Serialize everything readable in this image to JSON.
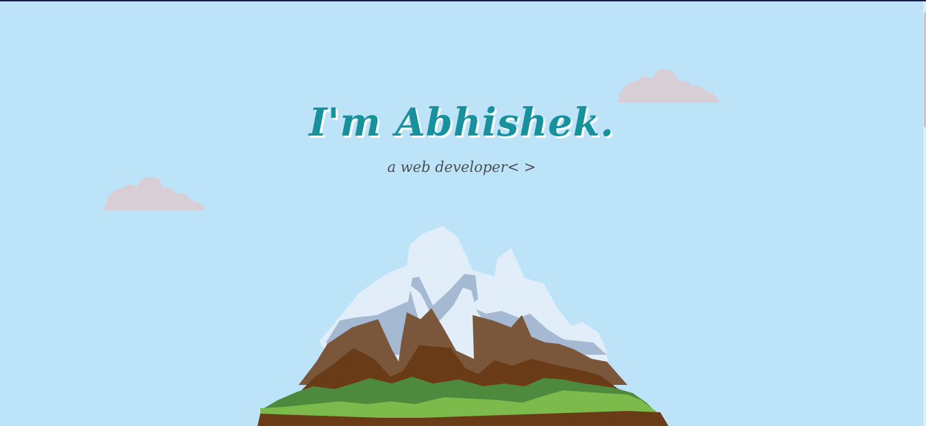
{
  "hero": {
    "title": "I'm Abhishek.",
    "subtitle": "a web developer< >"
  },
  "colors": {
    "sky": "#bde3f9",
    "title": "#17929c",
    "subtitle": "#4a4f55",
    "cloud": "#d8cfd6",
    "snow": "#e1eef9",
    "snow_shadow": "#a6b9d2",
    "rock_light": "#7a573a",
    "rock_dark": "#6a3b17",
    "grass_dark": "#4e8a3d",
    "grass_light": "#7cba4b",
    "soil": "#6a3b17"
  },
  "illustration": {
    "mountain": "mountain-illustration",
    "clouds": [
      "cloud-icon",
      "cloud-icon"
    ]
  }
}
